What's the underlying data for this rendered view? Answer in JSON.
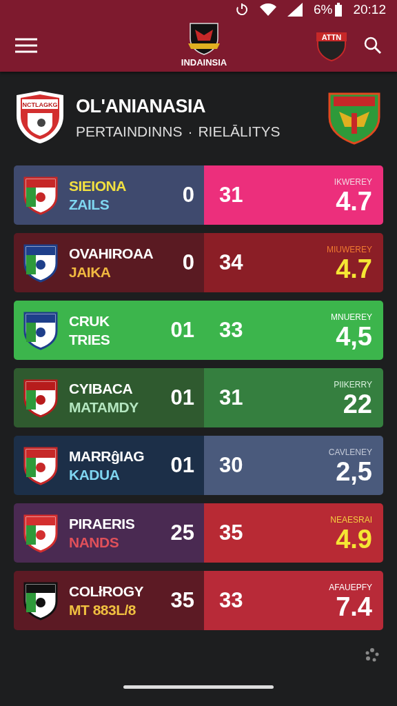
{
  "status_bar": {
    "battery": "6%",
    "time": "20:12"
  },
  "app_bar": {
    "title": "INDAINSIA",
    "crest_label": "ATTN"
  },
  "league": {
    "crest_label": "NCTLAGKG",
    "title": "OL'ANIANASIA",
    "subtitle": "PERTAINDINNS",
    "separator": "·",
    "subtitle_2": "RIELĀLITYS"
  },
  "matches": [
    {
      "color": "#3f4a6e",
      "crest": {
        "color": "#c62828"
      },
      "name": {
        "text": "SIEIONA",
        "color": "#f2e040"
      },
      "sub": {
        "text": "ZAILS",
        "color": "#7fd6f0"
      },
      "score_1": "0",
      "score_panel": {
        "color": "#ec2f7c"
      },
      "score_2": "31",
      "rating_label": {
        "text": "IKWEREY",
        "color": "#f3d6e0"
      },
      "rating": {
        "text": "4.7",
        "color": "#ffffff"
      }
    },
    {
      "color": "#5a1a22",
      "crest": {
        "color": "#1e3f8a"
      },
      "name": {
        "text": "OVAHIROAA",
        "color": "#ffffff"
      },
      "sub": {
        "text": "JAIKA",
        "color": "#f0b840"
      },
      "score_1": "0",
      "score_panel": {
        "color": "#8b1e26"
      },
      "score_2": "34",
      "rating_label": {
        "text": "MIUWEREY",
        "color": "#f07a30"
      },
      "rating": {
        "text": "4.7",
        "color": "#f5e634"
      }
    },
    {
      "color": "#3cb54c",
      "crest": {
        "color": "#1e3f8a"
      },
      "name": {
        "text": "CRUK",
        "color": "#ffffff"
      },
      "sub": {
        "text": "TRIES",
        "color": "#ffffff"
      },
      "score_1": "01",
      "score_panel": {
        "color": "#3cb54c"
      },
      "score_2": "33",
      "rating_label": {
        "text": "MNUEREY",
        "color": "#ffffff"
      },
      "rating": {
        "text": "4,5",
        "color": "#ffffff"
      }
    },
    {
      "color": "#2f5a2f",
      "crest": {
        "color": "#b71c1c"
      },
      "name": {
        "text": "CYIBACA",
        "color": "#ffffff"
      },
      "sub": {
        "text": "MATAMDY",
        "color": "#b4e6c0"
      },
      "score_1": "01",
      "score_panel": {
        "color": "#357f3f"
      },
      "score_2": "31",
      "rating_label": {
        "text": "PIIKERRY",
        "color": "#d8f0dc"
      },
      "rating": {
        "text": "22",
        "color": "#ffffff"
      }
    },
    {
      "color": "#1c2f48",
      "crest": {
        "color": "#c62828"
      },
      "name": {
        "text": "MARRĝIAG",
        "color": "#ffffff"
      },
      "sub": {
        "text": "KADUA",
        "color": "#7fd6f0"
      },
      "score_1": "01",
      "score_panel": {
        "color": "#4a5a7c"
      },
      "score_2": "30",
      "rating_label": {
        "text": "CAVLENEY",
        "color": "#c4cad8"
      },
      "rating": {
        "text": "2,5",
        "color": "#ffffff"
      }
    },
    {
      "color": "#4a2a52",
      "crest": {
        "color": "#d32f2f"
      },
      "name": {
        "text": "PIRAERIS",
        "color": "#ffffff"
      },
      "sub": {
        "text": "NANDS",
        "color": "#e0505a"
      },
      "score_1": "25",
      "score_panel": {
        "color": "#b82a34"
      },
      "score_2": "35",
      "rating_label": {
        "text": "NEAESRAI",
        "color": "#f5d040"
      },
      "rating": {
        "text": "4.9",
        "color": "#f5e634"
      }
    },
    {
      "color": "#5c1a24",
      "crest": {
        "color": "#111111"
      },
      "name": {
        "text": "COLłROGY",
        "color": "#ffffff"
      },
      "sub": {
        "text": "MT 883L/8",
        "color": "#f0c040"
      },
      "score_1": "35",
      "score_panel": {
        "color": "#b82a38"
      },
      "score_2": "33",
      "rating_label": {
        "text": "AFAUEPFY",
        "color": "#ffffff"
      },
      "rating": {
        "text": "7.4",
        "color": "#ffffff"
      }
    }
  ]
}
